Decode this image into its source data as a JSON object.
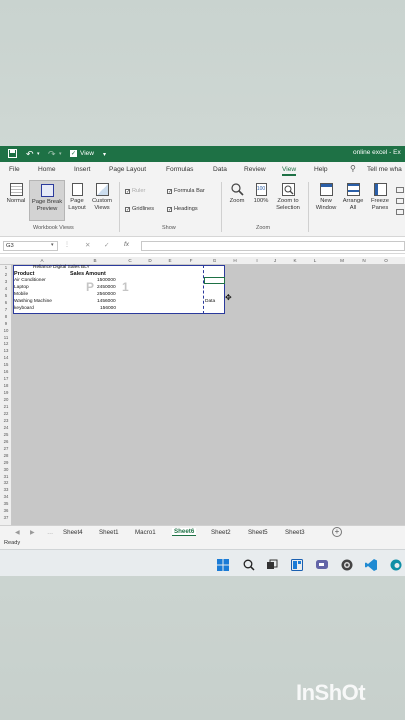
{
  "titlebar": {
    "view_label": "View",
    "title": "online excel - Ex"
  },
  "menu": {
    "items": [
      "File",
      "Home",
      "Insert",
      "Page Layout",
      "Formulas",
      "Data",
      "Review",
      "View",
      "Help"
    ],
    "tell_me": "Tell me wha"
  },
  "ribbon": {
    "workbook_views": {
      "normal": "Normal",
      "page_break": [
        "Page Break",
        "Preview"
      ],
      "page_layout": [
        "Page",
        "Layout"
      ],
      "custom_views": [
        "Custom",
        "Views"
      ],
      "group": "Workbook Views"
    },
    "show": {
      "ruler": "Ruler",
      "gridlines": "Gridlines",
      "formula_bar": "Formula Bar",
      "headings": "Headings",
      "group": "Show"
    },
    "zoom": {
      "zoom": "Zoom",
      "hundred": "100%",
      "zoom_to_selection": [
        "Zoom to",
        "Selection"
      ],
      "group": "Zoom"
    },
    "window": {
      "new_window": [
        "New",
        "Window"
      ],
      "arrange_all": [
        "Arrange",
        "All"
      ],
      "freeze_panes": [
        "Freeze",
        "Panes"
      ]
    }
  },
  "formula_bar": {
    "name_box": "G3",
    "fx": "fx"
  },
  "grid": {
    "columns": [
      "A",
      "B",
      "C",
      "D",
      "E",
      "F",
      "G",
      "H",
      "I",
      "J",
      "K",
      "L",
      "M",
      "N",
      "O"
    ],
    "rows": [
      "1",
      "2",
      "3",
      "4",
      "5",
      "6",
      "7",
      "8",
      "9",
      "10",
      "11",
      "12",
      "13",
      "14",
      "15",
      "16",
      "17",
      "18",
      "19",
      "20",
      "21",
      "22",
      "23",
      "24",
      "25",
      "26",
      "27",
      "28",
      "29",
      "30",
      "31",
      "32",
      "33",
      "34",
      "35",
      "36",
      "37"
    ],
    "table_title": "Reliance Digital Sales BLY",
    "header_product": "Product",
    "header_amount": "Sales Amount",
    "products": [
      "Air Conditioner",
      "Laptop",
      "Mobile",
      "Washing Machine",
      "keyboard"
    ],
    "amounts": [
      "1500000",
      "2450000",
      "2560000",
      "1456000",
      "156000"
    ],
    "page_label_1": "P",
    "page_label_2": "1",
    "extra_cell": "Data"
  },
  "sheets": {
    "tabs": [
      "Sheet4",
      "Sheet1",
      "Macro1",
      "Sheet6",
      "Sheet2",
      "Sheet5",
      "Sheet3"
    ],
    "active": "Sheet6"
  },
  "status": {
    "ready": "Ready"
  },
  "watermark": "InShOt",
  "colors": {
    "excel_green": "#1e7145",
    "page_border": "#2b3a9c"
  }
}
